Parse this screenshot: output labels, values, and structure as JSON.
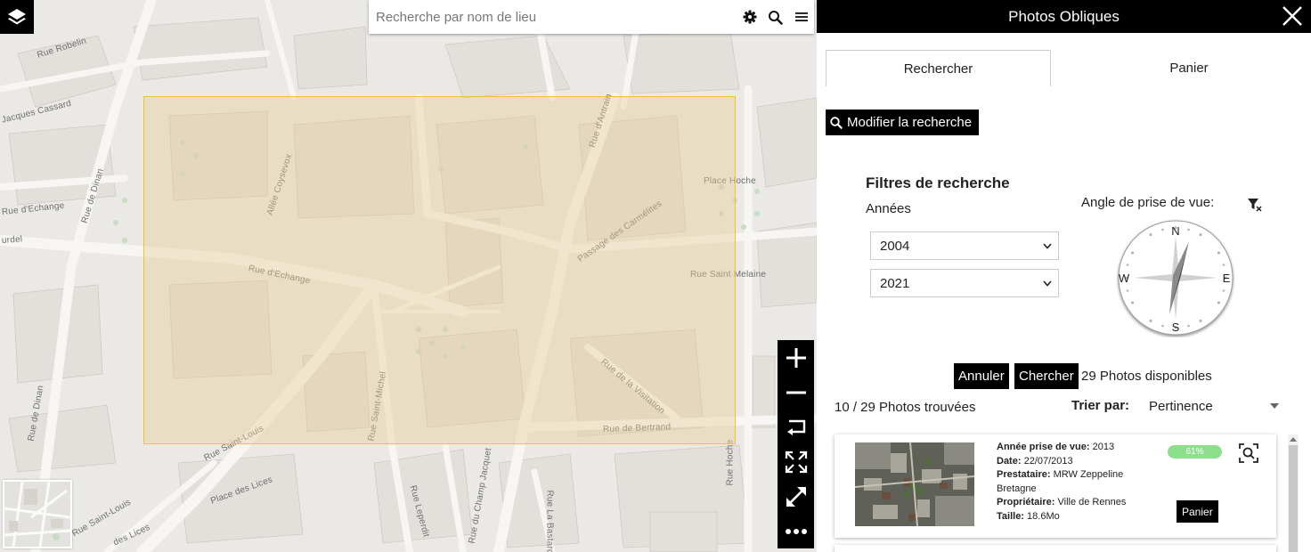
{
  "map": {
    "search_placeholder": "Recherche par nom de lieu",
    "street_labels": [
      "Rue Robelin",
      "Jacques Cassard",
      "Allée Coysevox",
      "Rue d'Antrain",
      "Place Hoche",
      "Passage des Carmélites",
      "Rue Saint Melaine",
      "Rue d'Echange",
      "Rue d'Echange",
      "Rue de Dinan",
      "urdel",
      "Rue de la Visitation",
      "Rue Saint-Michel",
      "Rue de Bertrand",
      "Rue Saint-Louis",
      "Place des Lices",
      "Rue Saint-Louis",
      "Rue Leperdit",
      "Rue du Champ Jacquet",
      "Rue La Bastard",
      "Rue de Dinan",
      "Rue Hoche",
      "des Lices"
    ],
    "icons": [
      "layers-icon",
      "gear-icon",
      "search-icon",
      "menu-icon",
      "zoom-in-icon",
      "zoom-out-icon",
      "rotate-icon",
      "fit-extent-icon",
      "fullscreen-icon",
      "more-icon"
    ]
  },
  "panel": {
    "title": "Photos Obliques",
    "tabs": [
      {
        "label": "Rechercher",
        "active": true
      },
      {
        "label": "Panier",
        "active": false
      }
    ],
    "modify_button": "Modifier la recherche",
    "filters_title": "Filtres de recherche",
    "years_label": "Années",
    "year_from": "2004",
    "year_to": "2021",
    "angle_label": "Angle de prise de vue:",
    "compass": {
      "n": "N",
      "s": "S",
      "e": "E",
      "w": "W"
    },
    "cancel_button": "Annuler",
    "search_button": "Chercher",
    "available_text": "29 Photos disponibles",
    "found_text": "10 / 29 Photos trouvées",
    "sort_label": "Trier par:",
    "sort_value": "Pertinence",
    "results": [
      {
        "year_label": "Année prise de vue:",
        "year": "2013",
        "date_label": "Date:",
        "date": "22/07/2013",
        "provider_label": "Prestataire:",
        "provider": "MRW Zeppeline Bretagne",
        "owner_label": "Propriétaire:",
        "owner": "Ville de Rennes",
        "size_label": "Taille:",
        "size": "18.6Mo",
        "match": "61%",
        "cart_button": "Panier"
      }
    ]
  },
  "colors": {
    "extent_border": "#f2c12e",
    "extent_fill": "#e6cd96",
    "match_badge": "#8ce08c",
    "header_bg": "#000000"
  }
}
